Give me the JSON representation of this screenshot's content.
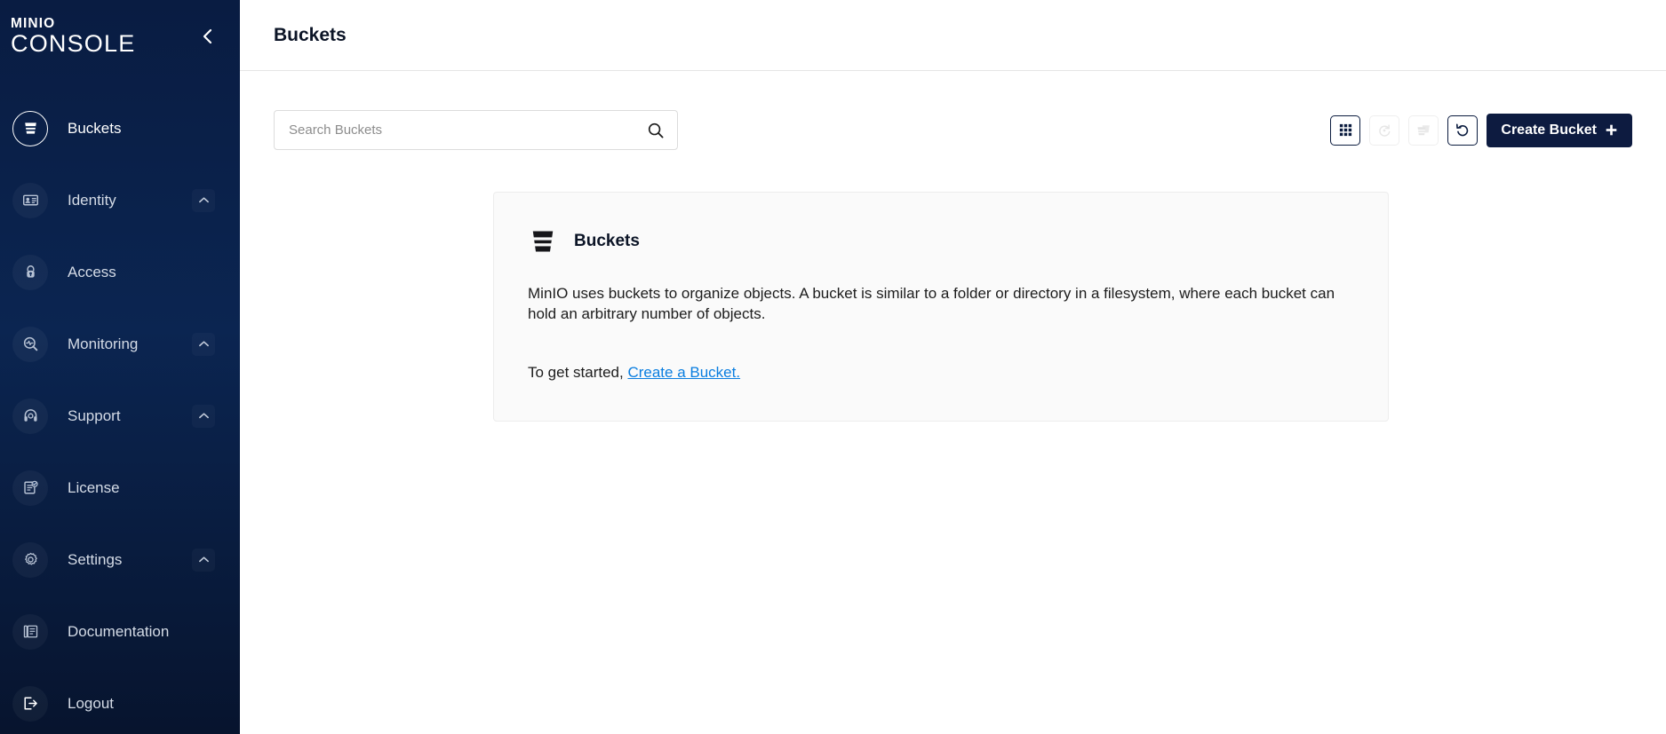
{
  "sidebar": {
    "logo_top": "MINIO",
    "logo_bottom": "CONSOLE",
    "collapse_icon": "chevron-left-icon",
    "items": [
      {
        "label": "Buckets",
        "icon": "bucket-icon",
        "active": true,
        "expandable": false
      },
      {
        "label": "Identity",
        "icon": "id-card-icon",
        "active": false,
        "expandable": true
      },
      {
        "label": "Access",
        "icon": "lock-icon",
        "active": false,
        "expandable": false
      },
      {
        "label": "Monitoring",
        "icon": "magnifier-pulse-icon",
        "active": false,
        "expandable": true
      },
      {
        "label": "Support",
        "icon": "headset-icon",
        "active": false,
        "expandable": true
      },
      {
        "label": "License",
        "icon": "license-doc-icon",
        "active": false,
        "expandable": false
      },
      {
        "label": "Settings",
        "icon": "gear-icon",
        "active": false,
        "expandable": true
      },
      {
        "label": "Documentation",
        "icon": "book-icon",
        "active": false,
        "expandable": false
      },
      {
        "label": "Logout",
        "icon": "logout-icon",
        "active": false,
        "expandable": false
      }
    ]
  },
  "header": {
    "title": "Buckets"
  },
  "search": {
    "placeholder": "Search Buckets",
    "value": ""
  },
  "toolbar": {
    "buttons": [
      {
        "name": "grid-view-button",
        "icon": "grid-icon",
        "enabled": true
      },
      {
        "name": "rewind-button",
        "icon": "rewind-icon",
        "enabled": false
      },
      {
        "name": "delete-buckets-button",
        "icon": "multiple-buckets-icon",
        "enabled": false
      },
      {
        "name": "refresh-button",
        "icon": "refresh-icon",
        "enabled": true
      }
    ],
    "create_label": "Create Bucket",
    "create_icon": "plus-icon"
  },
  "card": {
    "icon": "bucket-icon",
    "title": "Buckets",
    "description": "MinIO uses buckets to organize objects. A bucket is similar to a folder or directory in a filesystem, where each bucket can hold an arbitrary number of objects.",
    "cta_prefix": "To get started, ",
    "cta_link": "Create a Bucket."
  },
  "colors": {
    "sidebar_navy": "#0B2551",
    "brand_navy": "#0D1B40",
    "link_blue": "#0A7EE0",
    "card_bg": "#FAFAFA"
  }
}
